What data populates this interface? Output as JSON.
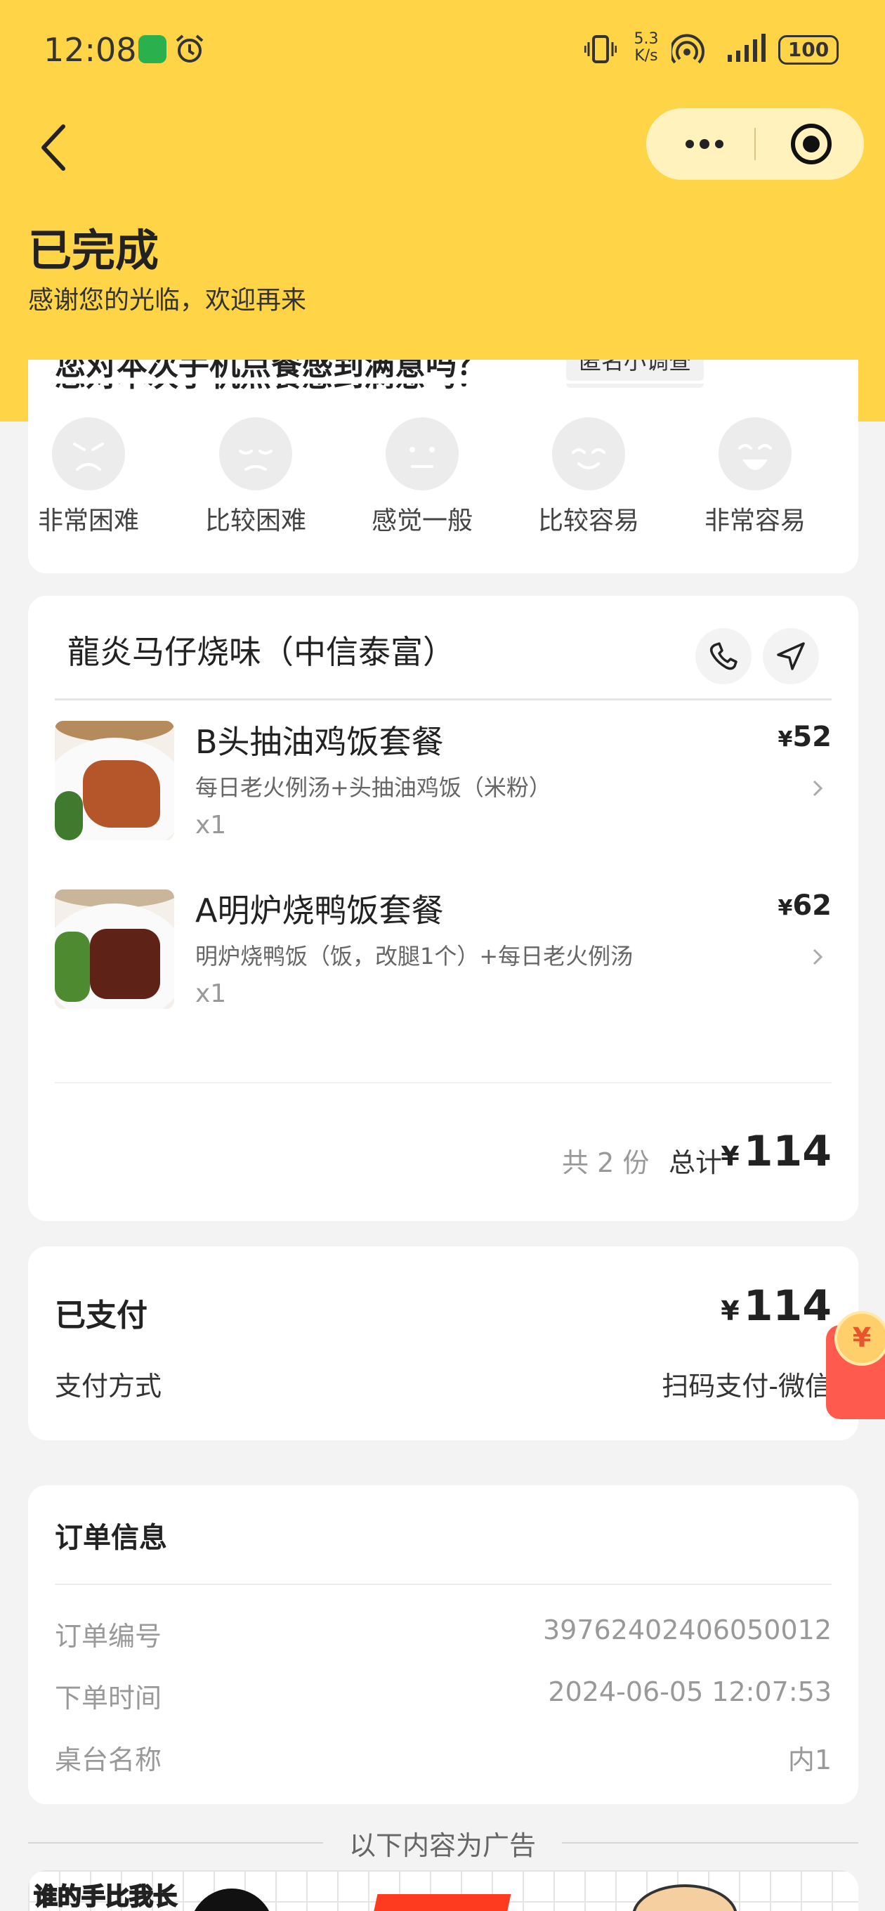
{
  "status_bar": {
    "time": "12:08",
    "network_speed": "5.3 K/s",
    "battery": "100",
    "icons": [
      "wechat-icon",
      "alarm-icon",
      "vibrate-icon",
      "hotspot-icon",
      "signal-icon",
      "battery-icon"
    ]
  },
  "header": {
    "status_title": "已完成",
    "status_subtitle": "感谢您的光临，欢迎再来"
  },
  "survey": {
    "question": "您对本次手机点餐感到满意吗？",
    "badge": "匿名小调查",
    "options": [
      {
        "label": "非常困难",
        "icon": "face-very-difficult-icon"
      },
      {
        "label": "比较困难",
        "icon": "face-difficult-icon"
      },
      {
        "label": "感觉一般",
        "icon": "face-neutral-icon"
      },
      {
        "label": "比较容易",
        "icon": "face-easy-icon"
      },
      {
        "label": "非常容易",
        "icon": "face-very-easy-icon"
      }
    ]
  },
  "store": {
    "name": "龍炎马仔烧味（中信泰富）",
    "items": [
      {
        "name": "B头抽油鸡饭套餐",
        "desc": "每日老火例汤+头抽油鸡饭（米粉）",
        "qty": "x1",
        "currency": "¥",
        "price": "52"
      },
      {
        "name": "A明炉烧鸭饭套餐",
        "desc": "明炉烧鸭饭（饭，改腿1个）+每日老火例汤",
        "qty": "x1",
        "currency": "¥",
        "price": "62"
      }
    ],
    "count_text": "共 2 份",
    "total_label": "总计",
    "total_currency": "¥",
    "total_value": "114"
  },
  "payment": {
    "paid_label": "已支付",
    "paid_currency": "¥",
    "paid_amount": "114",
    "method_label": "支付方式",
    "method_value": "扫码支付-微信"
  },
  "red_packet": {
    "symbol": "¥"
  },
  "order_info": {
    "title": "订单信息",
    "rows": [
      {
        "label": "订单编号",
        "value": "39762402406050012"
      },
      {
        "label": "下单时间",
        "value": "2024-06-05 12:07:53"
      },
      {
        "label": "桌台名称",
        "value": "内1"
      }
    ]
  },
  "ad": {
    "separator_label": "以下内容为广告",
    "banner_text": "谁的手比我长"
  },
  "colors": {
    "header_yellow": "#ffd447",
    "background": "#f3f3f3",
    "red_packet": "#ff5a4e"
  }
}
